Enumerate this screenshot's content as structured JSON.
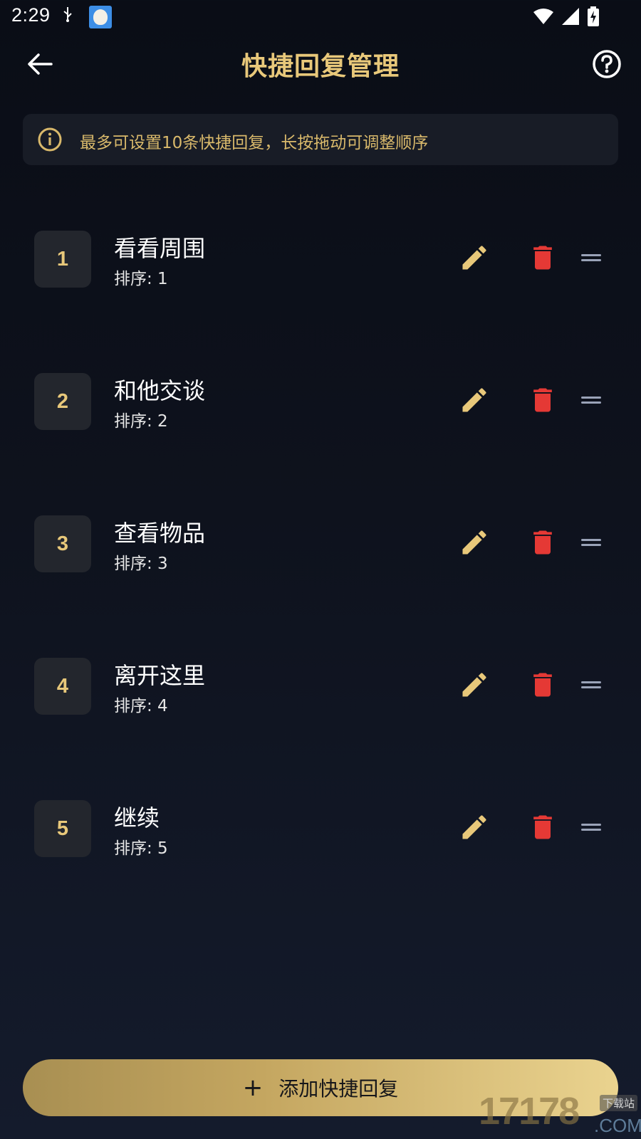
{
  "status_bar": {
    "time": "2:29",
    "notification_icon": "usb-debug-icon",
    "app_icon": "app-avatar-icon",
    "right_icons": [
      "wifi-icon",
      "signal-icon",
      "battery-charging-icon"
    ]
  },
  "header": {
    "title": "快捷回复管理",
    "back_icon": "arrow-left-icon",
    "help_icon": "help-circle-icon"
  },
  "info": {
    "icon": "info-circle-icon",
    "text": "最多可设置10条快捷回复，长按拖动可调整顺序"
  },
  "replies": [
    {
      "index": "1",
      "text": "看看周围",
      "order": "排序: 1"
    },
    {
      "index": "2",
      "text": "和他交谈",
      "order": "排序: 2"
    },
    {
      "index": "3",
      "text": "查看物品",
      "order": "排序: 3"
    },
    {
      "index": "4",
      "text": "离开这里",
      "order": "排序: 4"
    },
    {
      "index": "5",
      "text": "继续",
      "order": "排序: 5"
    }
  ],
  "item_actions": {
    "edit_icon": "pencil-icon",
    "delete_icon": "trash-icon",
    "drag_icon": "drag-handle-icon"
  },
  "add_button": {
    "icon": "plus-icon",
    "plus": "+",
    "label": "添加快捷回复"
  },
  "watermark": {
    "number": "17178",
    "tag": "下载站",
    "suffix": ".COM"
  },
  "colors": {
    "accent_gold": "#e8c87a",
    "delete_red": "#e53935",
    "drag_gray": "#9aa3b8",
    "badge_bg": "#23262d",
    "banner_bg": "#181c26"
  }
}
